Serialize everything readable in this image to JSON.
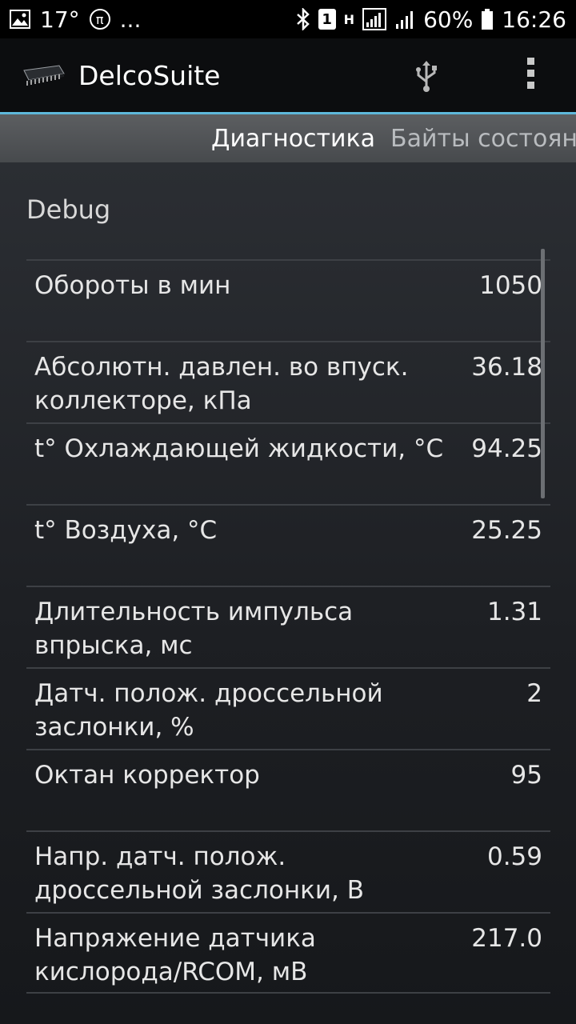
{
  "status_bar": {
    "temperature": "17°",
    "pi_symbol": "π",
    "more": "...",
    "sim_badge": "1",
    "network_type": "H",
    "battery": "60%",
    "time": "16:26"
  },
  "app_bar": {
    "title": "DelcoSuite"
  },
  "tabs": [
    {
      "label": "Диагностика",
      "active": true
    },
    {
      "label": "Байты состояни",
      "active": false
    }
  ],
  "section": {
    "title": "Debug"
  },
  "params": [
    {
      "label": "Обороты в мин",
      "value": "1050"
    },
    {
      "label": "Абсолютн. давлен. во впуск. коллекторе, кПа",
      "value": "36.18"
    },
    {
      "label": "t° Охлаждающей жидкости, °C",
      "value": "94.25"
    },
    {
      "label": "t° Воздуха, °C",
      "value": "25.25"
    },
    {
      "label": "Длительность импульса впрыска, мс",
      "value": "1.31"
    },
    {
      "label": "Датч. полож. дроссельной заслонки, %",
      "value": "2"
    },
    {
      "label": "Октан корректор",
      "value": "95"
    },
    {
      "label": "Напр. датч. полож. дроссельной заслонки, В",
      "value": "0.59"
    },
    {
      "label": "Напряжение датчика кислорода/RCOM, мВ",
      "value": "217.0"
    }
  ],
  "colors": {
    "accent": "#5eb8db",
    "background": "#121417"
  }
}
